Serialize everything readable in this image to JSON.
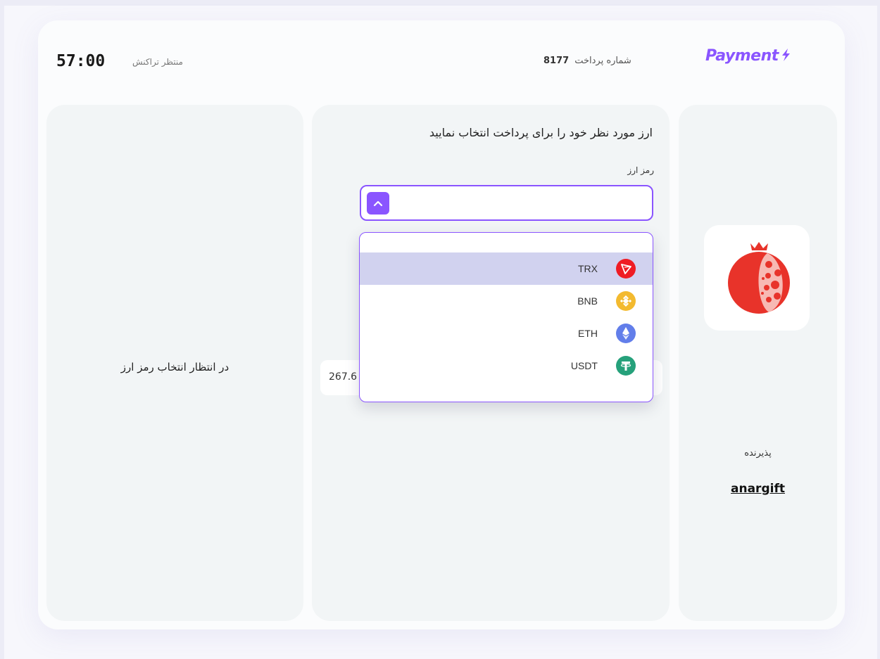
{
  "brand": {
    "logo_text": "Payment",
    "accent": "#8a55ff"
  },
  "header": {
    "payment_number_label": "شماره پرداخت",
    "payment_number": "8177",
    "timer": "57:00",
    "status_label": "منتظر تراکنش"
  },
  "left_panel": {
    "waiting_text": "در انتظار انتخاب رمز ارز"
  },
  "middle_panel": {
    "heading": "ارز مورد نظر خود را برای پرداخت انتخاب نمایید",
    "field_label": "رمز ارز",
    "amount_partial": "267.6"
  },
  "dropdown": {
    "options": [
      {
        "label": "TRX",
        "icon": "tron-icon",
        "color": "#ef1c24",
        "selected": true
      },
      {
        "label": "BNB",
        "icon": "bnb-icon",
        "color": "#f3ba2f",
        "selected": false
      },
      {
        "label": "ETH",
        "icon": "eth-icon",
        "color": "#627eea",
        "selected": false
      },
      {
        "label": "USDT",
        "icon": "usdt-icon",
        "color": "#26a17b",
        "selected": false
      }
    ]
  },
  "right_panel": {
    "acceptor_label": "پذیرنده",
    "acceptor_name": "anargift"
  }
}
